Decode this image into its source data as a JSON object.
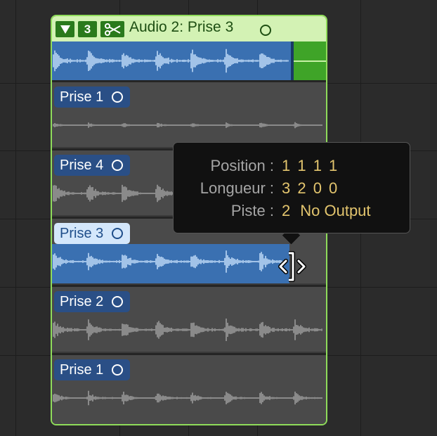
{
  "folder": {
    "take_count": "3",
    "title": "Audio 2: Prise 3",
    "colors": {
      "border": "#8fdc5a",
      "header": "#d3f2b4",
      "wave_blue": "#3a70b1",
      "green": "#3fa428"
    },
    "icons": [
      "disclosure-triangle-icon",
      "scissors-icon",
      "qc-ring-icon"
    ]
  },
  "takes": [
    {
      "label": "Prise 1",
      "selected": false
    },
    {
      "label": "Prise 4",
      "selected": false
    },
    {
      "label": "Prise 3",
      "selected": true
    },
    {
      "label": "Prise 2",
      "selected": false
    },
    {
      "label": "Prise 1",
      "selected": false
    }
  ],
  "tooltip": {
    "position_label": "Position :",
    "position_value": "1 1 1 1",
    "length_label": "Longueur :",
    "length_value": "3 2 0 0",
    "track_label": "Piste :",
    "track_value": "2",
    "track_output": "No Output"
  },
  "cursor": {
    "icon": "resize-trim-cursor-icon"
  }
}
